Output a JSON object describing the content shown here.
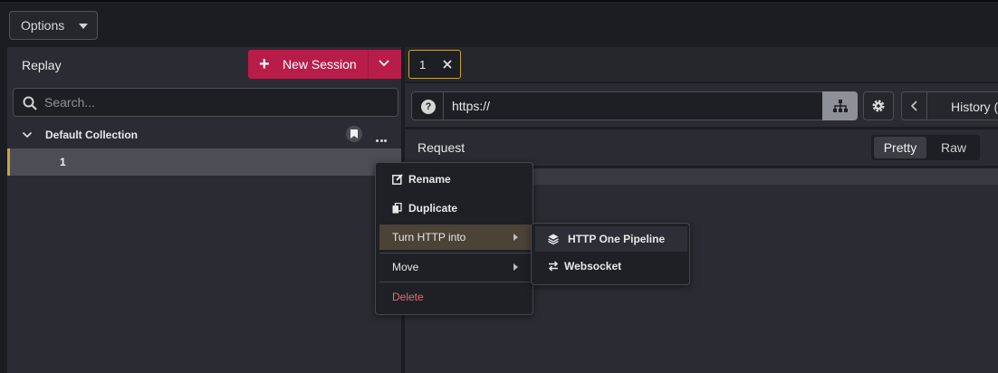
{
  "topbar": {
    "options_label": "Options"
  },
  "left": {
    "title": "Replay",
    "new_session_label": "New Session",
    "search_placeholder": "Search...",
    "collection_name": "Default Collection",
    "session_name": "1"
  },
  "tabs": [
    {
      "label": "1"
    }
  ],
  "url": {
    "value": "https://"
  },
  "history_label": "History (",
  "request": {
    "title": "Request",
    "views": [
      "Pretty",
      "Raw"
    ],
    "selected_view": "Pretty"
  },
  "context_menu": {
    "items": [
      "Rename",
      "Duplicate",
      "Turn HTTP into",
      "Move",
      "Delete"
    ],
    "highlighted": "Turn HTTP into"
  },
  "submenu": {
    "items": [
      "HTTP One Pipeline",
      "Websocket"
    ]
  },
  "colors": {
    "accent": "#b81d4a",
    "selected_border": "#c8a43a",
    "danger": "#e8677d",
    "background": "#1c1d22",
    "panel": "#2b2c33"
  },
  "icons": {
    "search": "search-icon",
    "bookmark": "bookmark-icon",
    "rename": "edit-icon",
    "duplicate": "copy-icon",
    "pipeline": "layers-icon",
    "websocket": "swap-icon",
    "settings": "gear-icon",
    "network": "network-icon",
    "help": "help-icon"
  }
}
